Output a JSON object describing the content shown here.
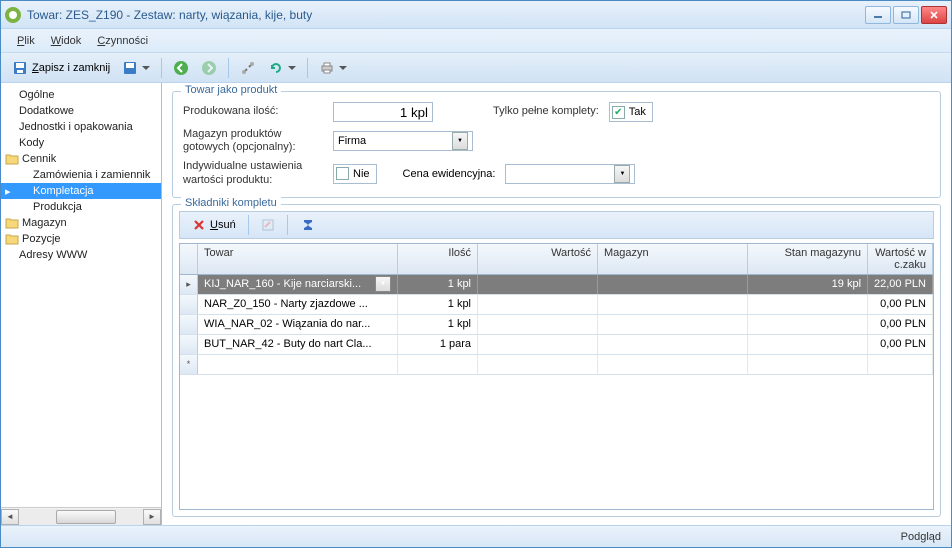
{
  "titlebar": {
    "title": "Towar: ZES_Z190 - Zestaw: narty, wiązania, kije, buty"
  },
  "menu": {
    "plik": "Plik",
    "widok": "Widok",
    "czynnosci": "Czynności"
  },
  "toolbar": {
    "save_close": "Zapisz i zamknij"
  },
  "sidebar": {
    "items": [
      {
        "label": "Ogólne",
        "type": "item"
      },
      {
        "label": "Dodatkowe",
        "type": "item"
      },
      {
        "label": "Jednostki i opakowania",
        "type": "item"
      },
      {
        "label": "Kody",
        "type": "item"
      },
      {
        "label": "Cennik",
        "type": "folder"
      },
      {
        "label": "Zamówienia i zamiennik",
        "type": "child"
      },
      {
        "label": "Kompletacja",
        "type": "child",
        "selected": true
      },
      {
        "label": "Produkcja",
        "type": "child"
      },
      {
        "label": "Magazyn",
        "type": "folder"
      },
      {
        "label": "Pozycje",
        "type": "folder"
      },
      {
        "label": "Adresy WWW",
        "type": "item"
      }
    ]
  },
  "product_group": {
    "title": "Towar jako produkt",
    "qty_label": "Produkowana ilość:",
    "qty_value": "1 kpl",
    "only_full_label": "Tylko pełne komplety:",
    "only_full_value": "Tak",
    "warehouse_label": "Magazyn produktów gotowych (opcjonalny):",
    "warehouse_value": "Firma",
    "individual_label": "Indywidualne ustawienia wartości produktu:",
    "individual_value": "Nie",
    "price_label": "Cena ewidencyjna:",
    "price_value": ""
  },
  "components_group": {
    "title": "Składniki kompletu",
    "delete_btn": "Usuń",
    "columns": {
      "towar": "Towar",
      "ilosc": "Ilość",
      "wartosc": "Wartość",
      "magazyn": "Magazyn",
      "stan": "Stan magazynu",
      "wcz": "Wartość w c.zaku"
    },
    "rows": [
      {
        "towar": "KIJ_NAR_160 - Kije narciarski...",
        "ilosc": "1 kpl",
        "wartosc": "",
        "magazyn": "",
        "stan": "19 kpl",
        "wcz": "22,00 PLN",
        "selected": true
      },
      {
        "towar": "NAR_Z0_150 - Narty zjazdowe ...",
        "ilosc": "1 kpl",
        "wartosc": "",
        "magazyn": "",
        "stan": "",
        "wcz": "0,00 PLN"
      },
      {
        "towar": "WIA_NAR_02 - Wiązania do nar...",
        "ilosc": "1 kpl",
        "wartosc": "",
        "magazyn": "",
        "stan": "",
        "wcz": "0,00 PLN"
      },
      {
        "towar": "BUT_NAR_42 - Buty do nart Cla...",
        "ilosc": "1 para",
        "wartosc": "",
        "magazyn": "",
        "stan": "",
        "wcz": "0,00 PLN"
      }
    ]
  },
  "statusbar": {
    "text": "Podgląd"
  }
}
